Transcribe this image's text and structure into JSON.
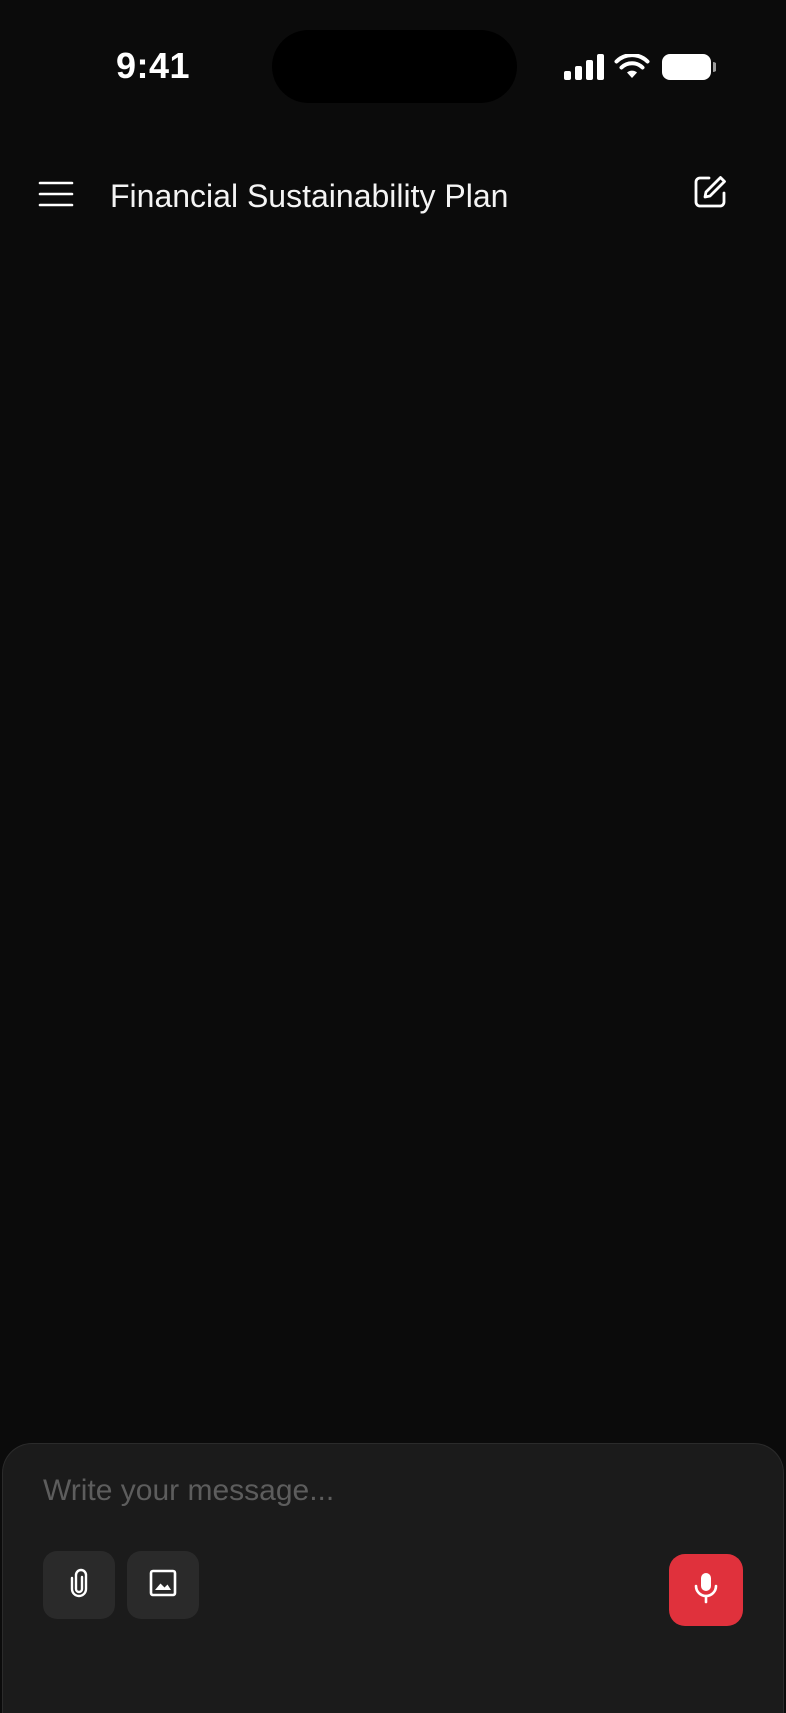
{
  "status_bar": {
    "time": "9:41",
    "icons": [
      "cellular-signal-icon",
      "wifi-icon",
      "battery-icon"
    ]
  },
  "header": {
    "title": "Financial Sustainability Plan",
    "menu_icon": "hamburger-menu-icon",
    "compose_icon": "edit-compose-icon"
  },
  "composer": {
    "placeholder": "Write your message...",
    "value": "",
    "tools": [
      {
        "icon": "paperclip-icon",
        "name": "attach"
      },
      {
        "icon": "image-icon",
        "name": "image"
      }
    ],
    "mic_icon": "microphone-icon"
  },
  "colors": {
    "background": "#0b0b0b",
    "composer_background": "#1b1b1b",
    "tool_button_background": "#2a2a2a",
    "accent": "#e0313c",
    "text": "#f4f4f4",
    "placeholder": "#5d5d5d"
  }
}
